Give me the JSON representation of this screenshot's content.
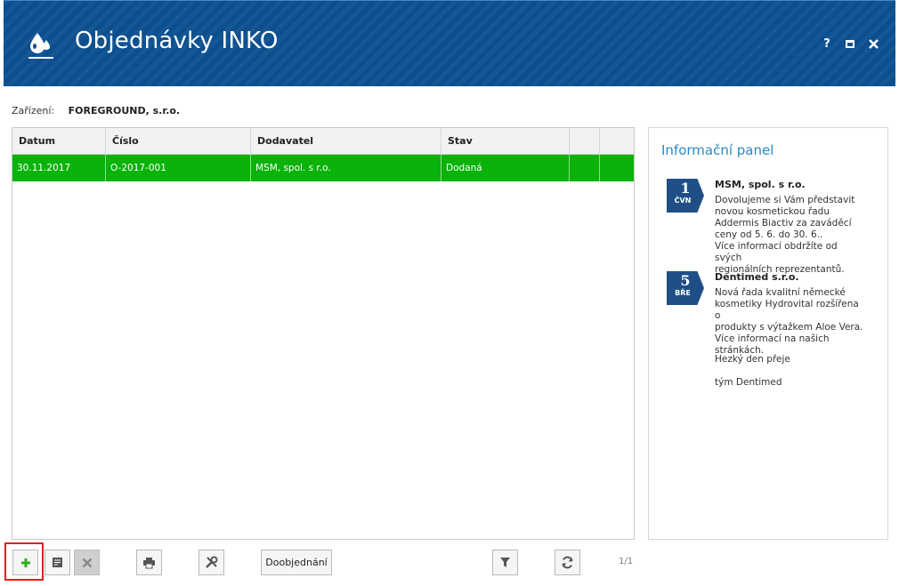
{
  "window": {
    "title": "Objednávky INKO",
    "help_label": "?",
    "icons": [
      "drop-logo-icon",
      "help-icon",
      "maximize-icon",
      "close-icon"
    ]
  },
  "device": {
    "label": "Zařízení:",
    "value": "FOREGROUND, s.r.o."
  },
  "grid": {
    "columns": [
      "Datum",
      "Číslo",
      "Dodavatel",
      "Stav",
      "",
      ""
    ],
    "rows": [
      {
        "datum": "30.11.2017",
        "cislo": "O-2017-001",
        "dodavatel": "MSM, spol. s r.o.",
        "stav": "Dodaná"
      }
    ],
    "selected_row_color": "#09b30a"
  },
  "info_panel": {
    "title": "Informační panel",
    "messages": [
      {
        "day": "1",
        "weekday": "ČVN",
        "from": "MSM, spol. s r.o.",
        "text": "Dovolujeme si Vám představit\nnovou kosmetickou řadu\nAddermis Biactiv za zaváděcí\nceny od 5. 6. do 30. 6..\nVíce informací obdržíte od svých\nregionálních reprezentantů."
      },
      {
        "day": "5",
        "weekday": "BŘE",
        "from": "Dentimed s.r.o.",
        "text": "Nová řada kvalitní německé\nkosmetiky Hydrovital rozšířena o\nprodukty s výtažkem Aloe Vera.\nVíce informací na našich\nstránkách."
      }
    ],
    "greeting": "Hezký den přeje",
    "signature": "tým Dentimed",
    "accent_color": "#2a8ac4",
    "badge_color": "#1f4f86"
  },
  "toolbar": {
    "reorder_label": "Doobjednání",
    "pager": "1/1",
    "icons": [
      "add-icon",
      "edit-icon",
      "delete-icon",
      "print-icon",
      "settings-icon",
      "filter-icon",
      "refresh-icon"
    ]
  }
}
